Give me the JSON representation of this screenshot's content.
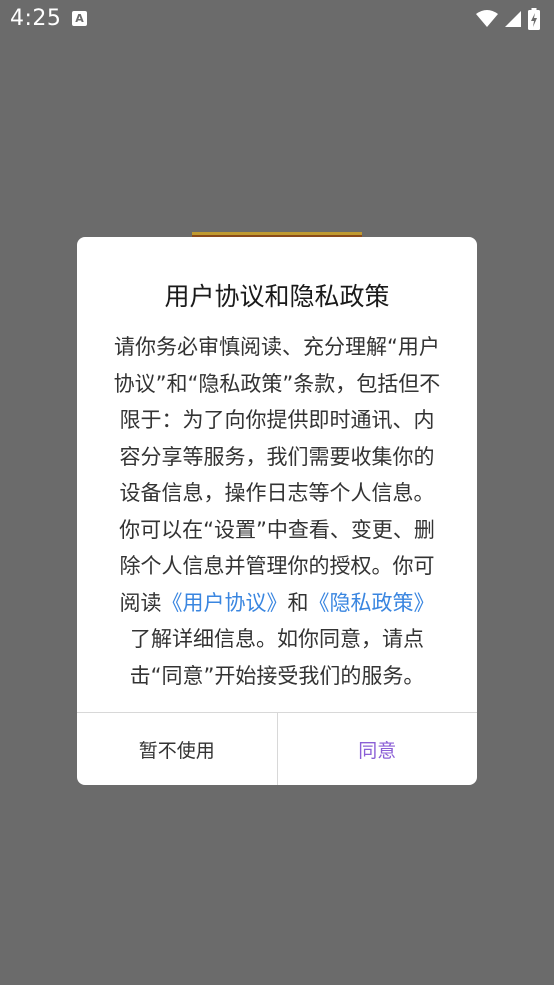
{
  "status_bar": {
    "time": "4:25",
    "notification_icon": "a-notification-icon",
    "icons": [
      "wifi-icon",
      "cell-signal-icon",
      "battery-charging-icon"
    ]
  },
  "dialog": {
    "title": "用户协议和隐私政策",
    "body_lines": [
      "请你务必审慎阅读、充分理解“用户",
      "协议”和“隐私政策”条款，包括但不",
      "限于：为了向你提供即时通讯、内",
      "容分享等服务，我们需要收集你的",
      "设备信息，操作日志等个人信息。",
      "你可以在“设置”中查看、变更、删",
      "除个人信息并管理你的授权。你可"
    ],
    "read_prefix": "阅读",
    "link_user_agreement": "《用户协议》",
    "and_text": "和",
    "link_privacy_policy": "《隐私政策》",
    "body_tail_lines": [
      "了解详细信息。如你同意，请点",
      "击“同意”开始接受我们的服务。"
    ],
    "decline_label": "暂不使用",
    "agree_label": "同意"
  },
  "colors": {
    "overlay": "#6b6b6b",
    "link": "#3a86e0",
    "agree": "#8b5fd6"
  }
}
